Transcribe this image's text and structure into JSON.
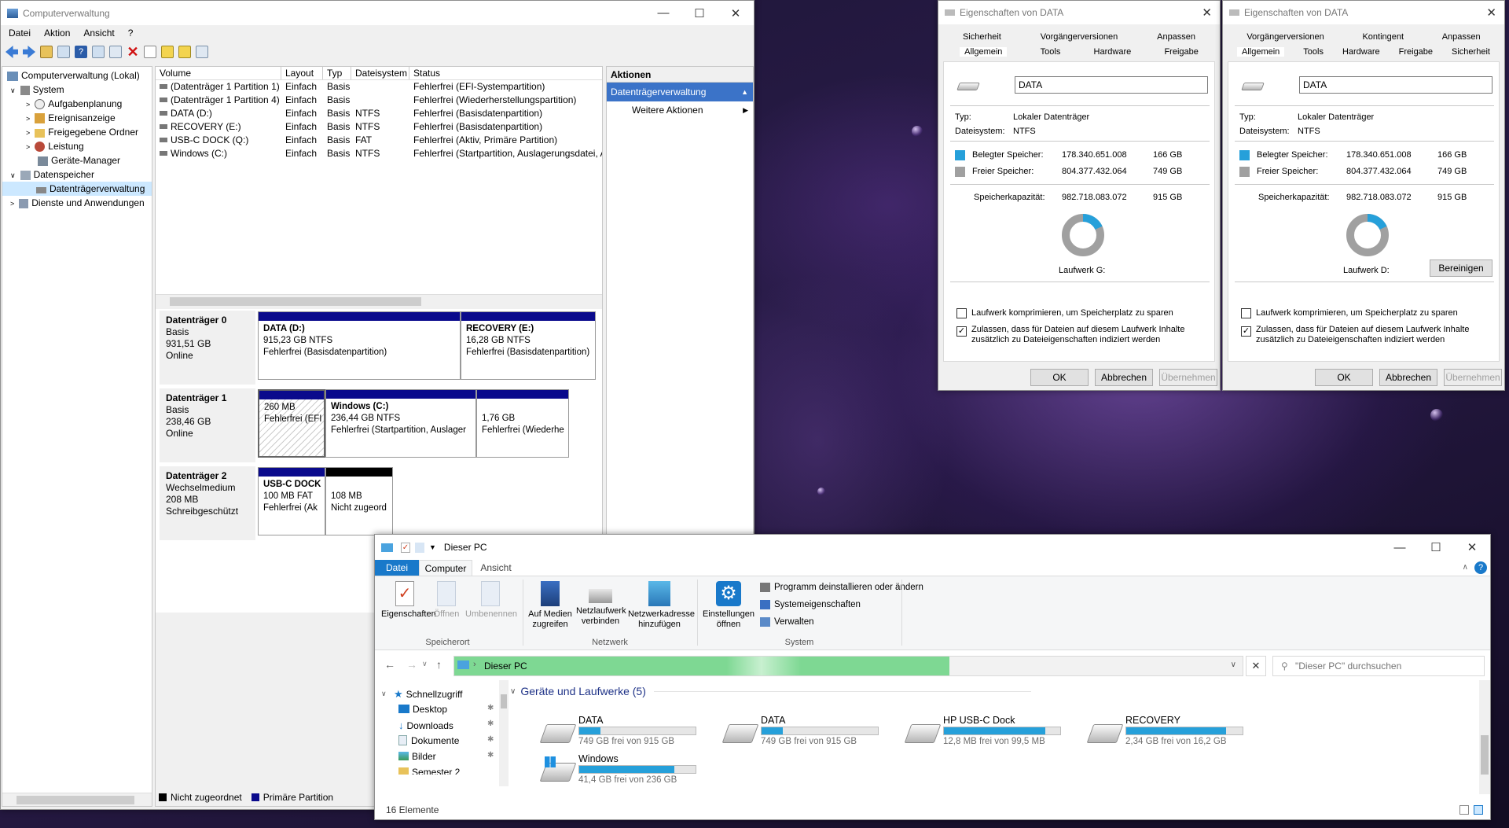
{
  "colors": {
    "accent": "#0078d7",
    "part_primary": "#0a0a8c",
    "part_unalloc": "#000000",
    "address_green": "#7ed893",
    "used": "#26a0da",
    "free_sq": "#a0a0a0"
  },
  "compmgmt": {
    "title": "Computerverwaltung",
    "menu": [
      "Datei",
      "Aktion",
      "Ansicht",
      "?"
    ],
    "tree": [
      {
        "label": "Computerverwaltung (Lokal)",
        "icon": "computer-icon"
      },
      {
        "label": "System",
        "icon": "tools-icon"
      },
      {
        "label": "Aufgabenplanung",
        "icon": "clock-icon"
      },
      {
        "label": "Ereignisanzeige",
        "icon": "event-icon"
      },
      {
        "label": "Freigegebene Ordner",
        "icon": "shared-folder-icon"
      },
      {
        "label": "Leistung",
        "icon": "performance-icon"
      },
      {
        "label": "Geräte-Manager",
        "icon": "device-icon"
      },
      {
        "label": "Datenspeicher",
        "icon": "storage-icon"
      },
      {
        "label": "Datenträgerverwaltung",
        "icon": "disk-icon"
      },
      {
        "label": "Dienste und Anwendungen",
        "icon": "services-icon"
      }
    ],
    "columns": [
      "Volume",
      "Layout",
      "Typ",
      "Dateisystem",
      "Status"
    ],
    "volumes": [
      {
        "vol": "(Datenträger 1 Partition 1)",
        "layout": "Einfach",
        "typ": "Basis",
        "fs": "",
        "status": "Fehlerfrei (EFI-Systempartition)"
      },
      {
        "vol": "(Datenträger 1 Partition 4)",
        "layout": "Einfach",
        "typ": "Basis",
        "fs": "",
        "status": "Fehlerfrei (Wiederherstellungspartition)"
      },
      {
        "vol": "DATA (D:)",
        "layout": "Einfach",
        "typ": "Basis",
        "fs": "NTFS",
        "status": "Fehlerfrei (Basisdatenpartition)"
      },
      {
        "vol": "RECOVERY (E:)",
        "layout": "Einfach",
        "typ": "Basis",
        "fs": "NTFS",
        "status": "Fehlerfrei (Basisdatenpartition)"
      },
      {
        "vol": "USB-C DOCK (Q:)",
        "layout": "Einfach",
        "typ": "Basis",
        "fs": "FAT",
        "status": "Fehlerfrei (Aktiv, Primäre Partition)"
      },
      {
        "vol": "Windows (C:)",
        "layout": "Einfach",
        "typ": "Basis",
        "fs": "NTFS",
        "status": "Fehlerfrei (Startpartition, Auslagerungsdatei, A"
      }
    ],
    "disks": [
      {
        "name": "Datenträger 0",
        "l1": "Basis",
        "l2": "931,51 GB",
        "l3": "Online"
      },
      {
        "name": "Datenträger 1",
        "l1": "Basis",
        "l2": "238,46 GB",
        "l3": "Online"
      },
      {
        "name": "Datenträger 2",
        "l1": "Wechselmedium",
        "l2": "208 MB",
        "l3": "Schreibgeschützt"
      }
    ],
    "parts": {
      "d0a": {
        "t": "DATA  (D:)",
        "s": "915,23 GB NTFS",
        "st": "Fehlerfrei (Basisdatenpartition)"
      },
      "d0b": {
        "t": "RECOVERY  (E:)",
        "s": "16,28 GB NTFS",
        "st": "Fehlerfrei (Basisdatenpartition)"
      },
      "d1a": {
        "s": "260 MB",
        "st": "Fehlerfrei (EFI"
      },
      "d1b": {
        "t": "Windows  (C:)",
        "s": "236,44 GB NTFS",
        "st": "Fehlerfrei (Startpartition, Auslager"
      },
      "d1c": {
        "s": "1,76 GB",
        "st": "Fehlerfrei (Wiederhe"
      },
      "d2a": {
        "t": "USB-C DOCK",
        "s": "100 MB FAT",
        "st": "Fehlerfrei (Ak"
      },
      "d2b": {
        "s": "108 MB",
        "st": "Nicht zugeord"
      }
    },
    "legend": {
      "unalloc": "Nicht zugeordnet",
      "primary": "Primäre Partition"
    },
    "actions": {
      "header": "Aktionen",
      "section": "Datenträgerverwaltung",
      "more": "Weitere Aktionen"
    }
  },
  "props1": {
    "title": "Eigenschaften von DATA",
    "tabs_row1": [
      "Sicherheit",
      "Vorgängerversionen",
      "Anpassen"
    ],
    "tabs_row2": [
      "Allgemein",
      "Tools",
      "Hardware",
      "Freigabe"
    ],
    "name": "DATA",
    "typ_label": "Typ:",
    "typ": "Lokaler Datenträger",
    "fs_label": "Dateisystem:",
    "fs": "NTFS",
    "used_label": "Belegter Speicher:",
    "used_bytes": "178.340.651.008",
    "used_gb": "166 GB",
    "free_label": "Freier Speicher:",
    "free_bytes": "804.377.432.064",
    "free_gb": "749 GB",
    "cap_label": "Speicherkapazität:",
    "cap_bytes": "982.718.083.072",
    "cap_gb": "915 GB",
    "drive": "Laufwerk G:",
    "used_fraction": 0.181,
    "compress": "Laufwerk komprimieren, um Speicherplatz zu sparen",
    "index": "Zulassen, dass für Dateien auf diesem Laufwerk Inhalte zusätzlich zu Dateieigenschaften indiziert werden",
    "ok": "OK",
    "cancel": "Abbrechen",
    "apply": "Übernehmen"
  },
  "props2": {
    "title": "Eigenschaften von DATA",
    "tabs_row1": [
      "Vorgängerversionen",
      "Kontingent",
      "Anpassen"
    ],
    "tabs_row2": [
      "Allgemein",
      "Tools",
      "Hardware",
      "Freigabe",
      "Sicherheit"
    ],
    "name": "DATA",
    "typ_label": "Typ:",
    "typ": "Lokaler Datenträger",
    "fs_label": "Dateisystem:",
    "fs": "NTFS",
    "used_label": "Belegter Speicher:",
    "used_bytes": "178.340.651.008",
    "used_gb": "166 GB",
    "free_label": "Freier Speicher:",
    "free_bytes": "804.377.432.064",
    "free_gb": "749 GB",
    "cap_label": "Speicherkapazität:",
    "cap_bytes": "982.718.083.072",
    "cap_gb": "915 GB",
    "drive": "Laufwerk D:",
    "cleanup": "Bereinigen",
    "used_fraction": 0.181,
    "compress": "Laufwerk komprimieren, um Speicherplatz zu sparen",
    "index": "Zulassen, dass für Dateien auf diesem Laufwerk Inhalte zusätzlich zu Dateieigenschaften indiziert werden",
    "ok": "OK",
    "cancel": "Abbrechen",
    "apply": "Übernehmen"
  },
  "explorer": {
    "title": "Dieser PC",
    "tabs": [
      "Datei",
      "Computer",
      "Ansicht"
    ],
    "ribbon": {
      "eig": "Eigenschaften",
      "oeff": "Öffnen",
      "umb": "Umbenennen",
      "grp1": "Speicherort",
      "medien": "Auf Medien zugreifen",
      "netzlw": "Netzlaufwerk verbinden",
      "netzadr": "Netzwerkadresse hinzufügen",
      "grp2": "Netzwerk",
      "einst": "Einstellungen öffnen",
      "prog": "Programm deinstallieren oder ändern",
      "syseig": "Systemeigenschaften",
      "verw": "Verwalten",
      "grp3": "System"
    },
    "address": "Dieser PC",
    "search_placeholder": "\"Dieser PC\" durchsuchen",
    "nav": [
      {
        "label": "Schnellzugriff",
        "icon": "star-icon"
      },
      {
        "label": "Desktop",
        "icon": "desktop-icon"
      },
      {
        "label": "Downloads",
        "icon": "download-icon"
      },
      {
        "label": "Dokumente",
        "icon": "documents-icon"
      },
      {
        "label": "Bilder",
        "icon": "pictures-icon"
      },
      {
        "label": "Semester 2",
        "icon": "folder-icon"
      }
    ],
    "group": "Geräte und Laufwerke (5)",
    "drives": [
      {
        "name": "DATA",
        "free": "749 GB frei von 915 GB",
        "used_fraction": 0.18
      },
      {
        "name": "DATA",
        "free": "749 GB frei von 915 GB",
        "used_fraction": 0.18
      },
      {
        "name": "HP USB-C Dock",
        "free": "12,8 MB frei von 99,5 MB",
        "used_fraction": 0.87
      },
      {
        "name": "RECOVERY",
        "free": "2,34 GB frei von 16,2 GB",
        "used_fraction": 0.86
      },
      {
        "name": "Windows",
        "free": "41,4 GB frei von 236 GB",
        "used_fraction": 0.82
      }
    ],
    "status": "16 Elemente"
  }
}
